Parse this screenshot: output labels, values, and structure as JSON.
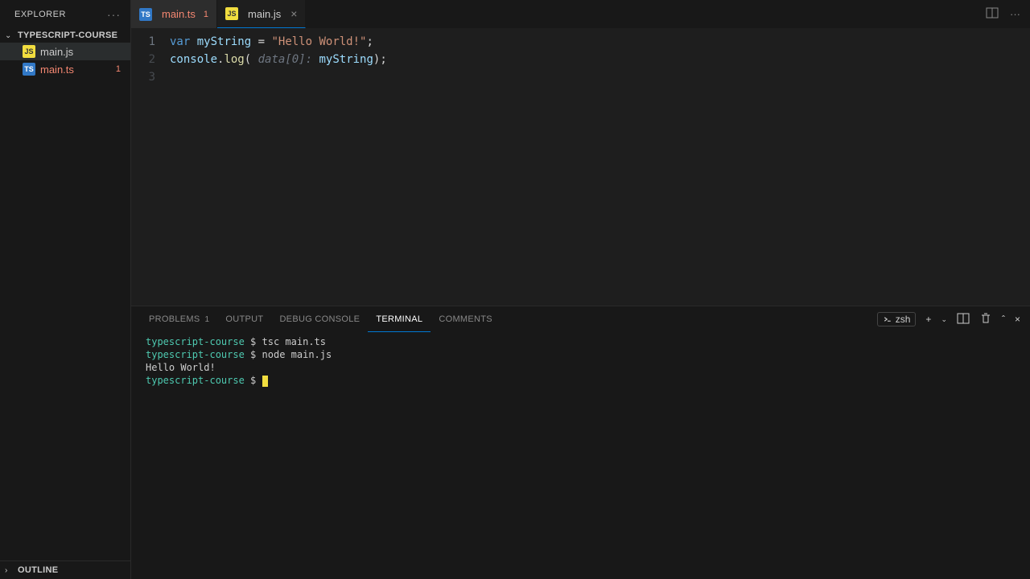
{
  "sidebar": {
    "title": "EXPLORER",
    "folder": "TYPESCRIPT-COURSE",
    "files": [
      {
        "name": "main.js",
        "type": "js",
        "error": false,
        "badge": ""
      },
      {
        "name": "main.ts",
        "type": "ts",
        "error": true,
        "badge": "1"
      }
    ],
    "outline": "OUTLINE"
  },
  "tabs": [
    {
      "name": "main.ts",
      "type": "ts",
      "error": true,
      "badge": "1",
      "active": false
    },
    {
      "name": "main.js",
      "type": "js",
      "error": false,
      "badge": "",
      "active": true
    }
  ],
  "editor": {
    "line_numbers": [
      "1",
      "2",
      "3"
    ],
    "line1": {
      "kw": "var",
      "var": "myString",
      "eq": " = ",
      "str": "\"Hello World!\"",
      "end": ";"
    },
    "line2": {
      "obj": "console",
      "dot": ".",
      "fn": "log",
      "open": "( ",
      "hint": "data[0]:",
      "sp": " ",
      "arg": "myString",
      "close": ");"
    }
  },
  "panel": {
    "tabs": {
      "problems": "PROBLEMS",
      "problems_badge": "1",
      "output": "OUTPUT",
      "debug_console": "DEBUG CONSOLE",
      "terminal": "TERMINAL",
      "comments": "COMMENTS"
    },
    "shell": "zsh"
  },
  "terminal": {
    "prompt": "typescript-course",
    "dollar": " $ ",
    "lines": [
      {
        "cmd": "tsc main.ts"
      },
      {
        "cmd": "node main.js"
      },
      {
        "out": "Hello World!"
      }
    ]
  }
}
